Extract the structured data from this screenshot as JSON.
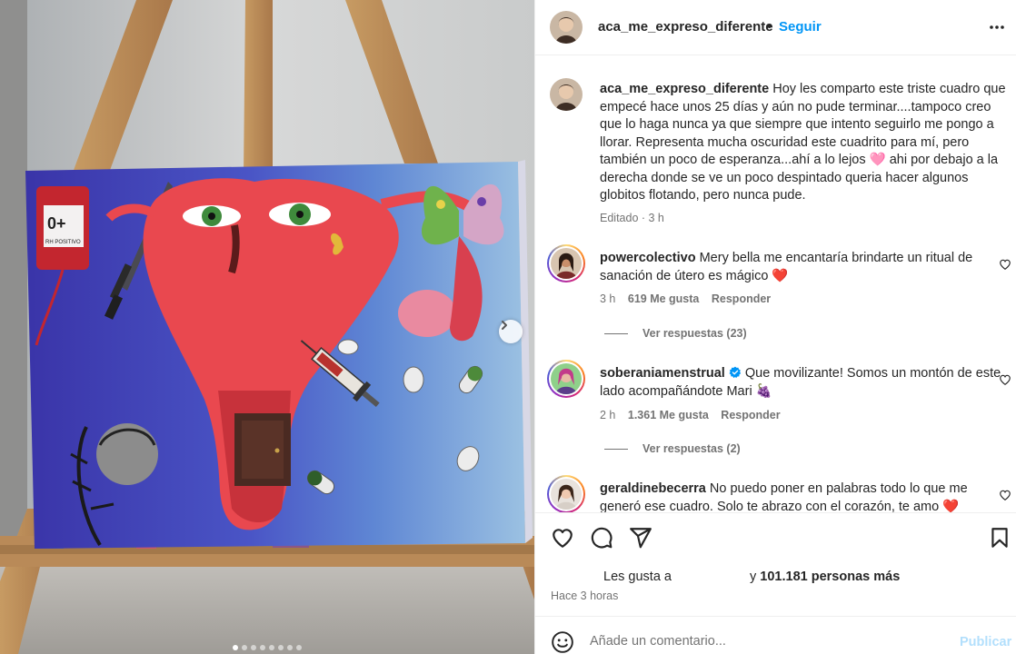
{
  "post": {
    "username": "aca_me_expreso_diferente",
    "separator": "•",
    "follow_label": "Seguir",
    "more_icon": "more-horizontal-icon",
    "carousel": {
      "total_slides": 8,
      "active_slide": 1,
      "next_icon": "chevron-right-icon"
    },
    "painting_text": {
      "blood_bag_type": "0+",
      "blood_bag_label": "RH POSITIVO"
    }
  },
  "caption": {
    "username": "aca_me_expreso_diferente",
    "text": "Hoy les comparto este triste cuadro que empecé hace unos 25 días y aún no pude terminar....tampoco creo que lo haga nunca ya que siempre que intento seguirlo me pongo a llorar. Representa mucha oscuridad este cuadrito para mí, pero también un poco de esperanza...ahí a lo lejos 🩷  ahi por debajo a la derecha donde se ve un poco despintado queria hacer algunos globitos flotando, pero nunca pude.",
    "meta": "Editado · 3 h"
  },
  "comments": [
    {
      "username": "powercolectivo",
      "text": "Mery bella me encantaría brindarte un ritual de sanación de útero es mágico ❤️",
      "time": "3 h",
      "likes": "619 Me gusta",
      "reply_label": "Responder",
      "view_replies": "Ver respuestas (23)"
    },
    {
      "username": "soberaniamenstrual",
      "verified": true,
      "text": "Que movilizante! Somos un montón de este lado acompañándote Mari 🍇",
      "time": "2 h",
      "likes": "1.361 Me gusta",
      "reply_label": "Responder",
      "view_replies": "Ver respuestas (2)"
    },
    {
      "username": "geraldinebecerra",
      "text": "No puedo poner en palabras todo lo que me generó ese cuadro. Solo te abrazo con el corazón, te amo ❤️"
    }
  ],
  "actions": {
    "like_icon": "heart-icon",
    "comment_icon": "comment-icon",
    "share_icon": "send-icon",
    "save_icon": "bookmark-icon",
    "likes_prefix": "Les gusta a",
    "likes_middle": "y",
    "likes_count": "101.181 personas más",
    "time_ago": "Hace 3 horas"
  },
  "add_comment": {
    "emoji_icon": "emoji-icon",
    "placeholder": "Añade un comentario...",
    "publish_label": "Publicar"
  },
  "colors": {
    "accent": "#0095f6",
    "publish_disabled": "#b2dffc",
    "muted_text": "#737373",
    "heart_red": "#ff3040"
  }
}
